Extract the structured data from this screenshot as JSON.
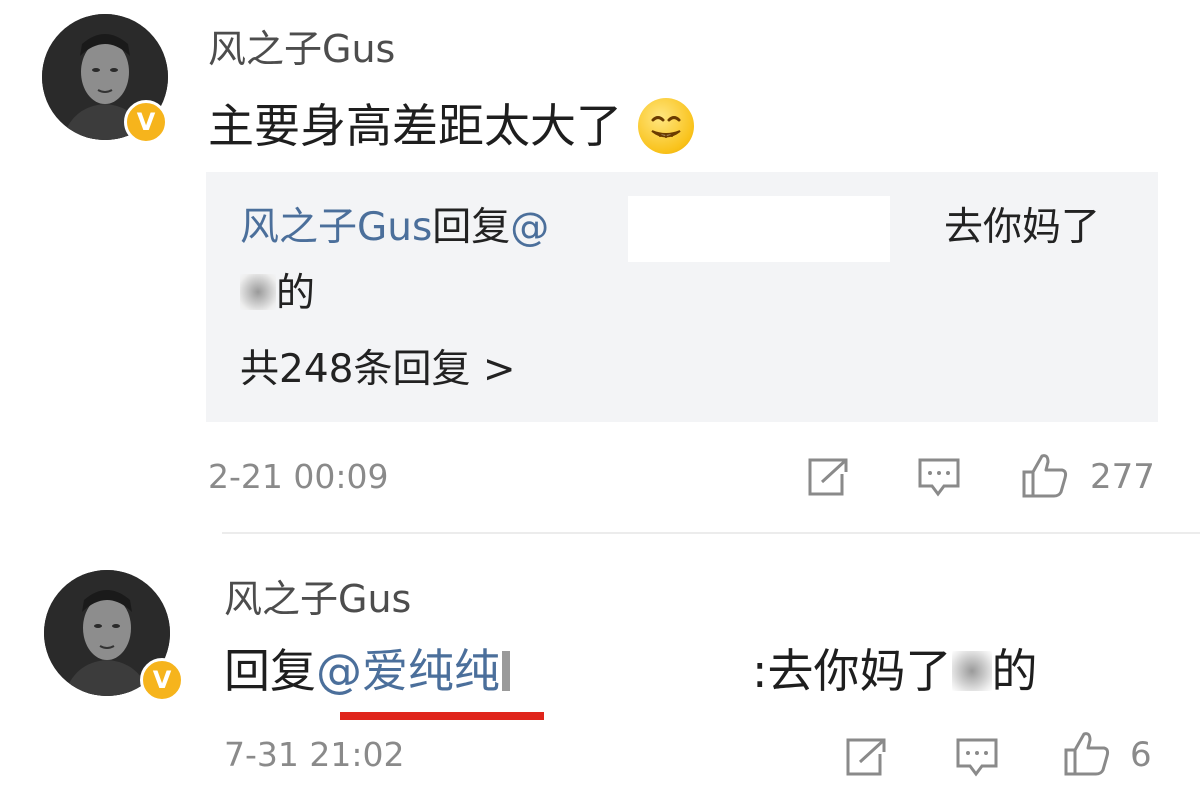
{
  "comments": [
    {
      "username": "风之子Gus",
      "text": "主要身高差距太大了",
      "emoji": "smirk-emoji",
      "reply": {
        "author": "风之子Gus",
        "reply_word": "回复",
        "at": "@",
        "tail": "去你妈了",
        "second_line_tail": "的",
        "count_label": "共248条回复 >"
      },
      "timestamp": "2-21 00:09",
      "like_count": "277"
    },
    {
      "username": "风之子Gus",
      "reply_word": "回复",
      "mention": "@爱纯纯",
      "tail": ":去你妈了",
      "tail_end": "的",
      "timestamp": "7-31 21:02",
      "like_count": "6"
    }
  ],
  "colors": {
    "link": "#4b6f9b",
    "badge": "#f6b41c",
    "underline": "#e0251b",
    "reply_bg": "#f3f4f6"
  },
  "icons": [
    "repost-icon",
    "comment-icon",
    "like-icon",
    "verified-badge-icon"
  ]
}
